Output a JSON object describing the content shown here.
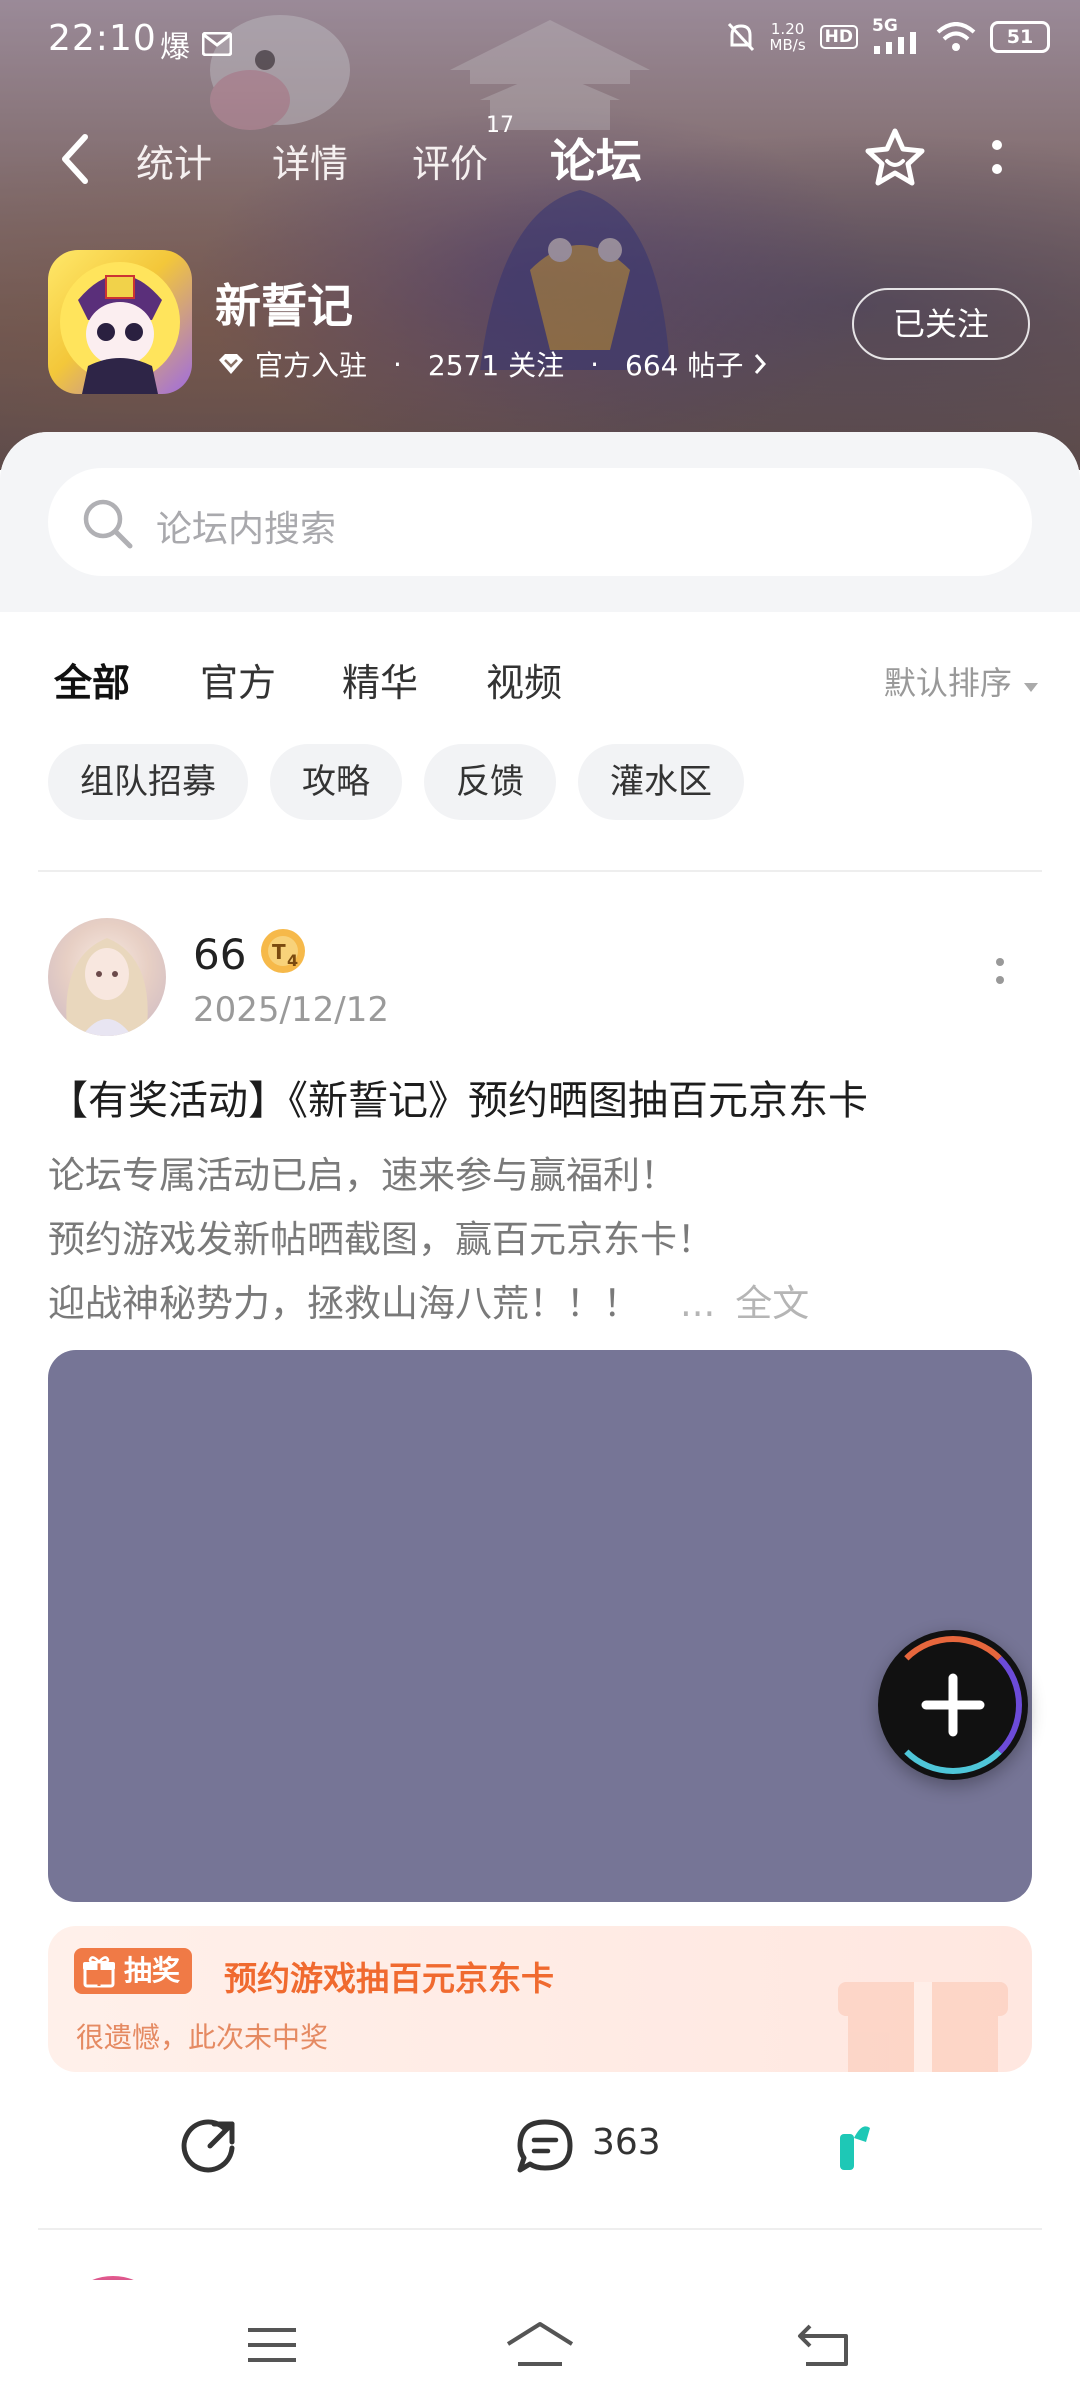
{
  "status_bar": {
    "time": "22:10",
    "extra_glyph": "爆",
    "net_speed_value": "1.20",
    "net_speed_unit": "MB/s",
    "hd_label": "HD",
    "signal_label": "5G",
    "battery": "51"
  },
  "nav": {
    "tabs": [
      {
        "label": "统计"
      },
      {
        "label": "详情"
      },
      {
        "label": "评价"
      },
      {
        "label": "论坛"
      }
    ],
    "active_tab": "论坛",
    "review_count": "17"
  },
  "game": {
    "name": "新誓记",
    "official_label": "官方入驻",
    "followers": "2571 关注",
    "posts": "664 帖子",
    "separator": "·",
    "follow_button": "已关注"
  },
  "search": {
    "placeholder": "论坛内搜索"
  },
  "filter_tabs": [
    {
      "label": "全部"
    },
    {
      "label": "官方"
    },
    {
      "label": "精华"
    },
    {
      "label": "视频"
    }
  ],
  "active_filter": "全部",
  "sort_label": "默认排序",
  "chips": [
    {
      "label": "组队招募"
    },
    {
      "label": "攻略"
    },
    {
      "label": "反馈"
    },
    {
      "label": "灌水区"
    }
  ],
  "post": {
    "username": "66",
    "level_badge": "4",
    "date": "2025/12/12",
    "title": "【有奖活动】《新誓记》预约晒图抽百元京东卡",
    "body_lines": [
      "论坛专属活动已启，速来参与赢福利！",
      "预约游戏发新帖晒截图，赢百元京东卡！",
      "迎战神秘势力，拯救山海八荒！！！"
    ],
    "ellipsis": "...",
    "expand_label": "全文",
    "image_color": "#767596",
    "lottery": {
      "tag": "抽奖",
      "title": "预约游戏抽百元京东卡",
      "result": "很遗憾，此次未中奖"
    },
    "comment_count": "363"
  },
  "colors": {
    "accent": "#1ec8b6",
    "lottery_orange": "#f07a46"
  },
  "icons": [
    "back-arrow-icon",
    "star-icon",
    "more-vertical-icon",
    "diamond-icon",
    "chevron-right-icon",
    "search-icon",
    "sort-caret-icon",
    "share-icon",
    "comment-icon",
    "like-icon",
    "plus-icon",
    "gift-icon",
    "menu-icon",
    "home-icon",
    "return-icon"
  ]
}
